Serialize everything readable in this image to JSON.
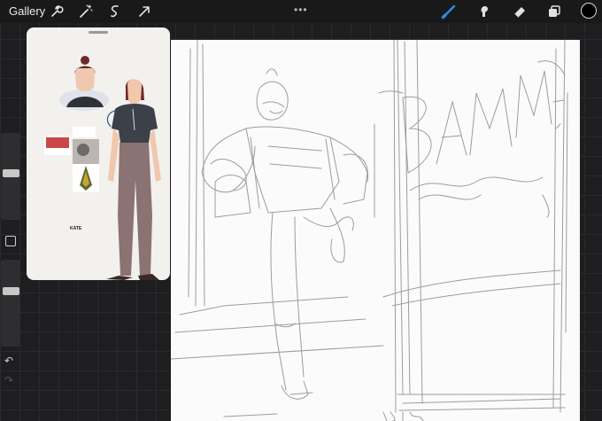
{
  "topbar": {
    "gallery_label": "Gallery",
    "left_tools": [
      "wrench-icon",
      "magic-wand-icon",
      "selection-icon",
      "transform-arrow-icon"
    ],
    "right_tools": [
      "brush-icon",
      "smudge-icon",
      "eraser-icon",
      "layers-icon"
    ],
    "more_glyph": "•••",
    "active_color": "#000000"
  },
  "reference": {
    "character_label": "KATE",
    "accent_color": "#2b8be6"
  },
  "sidebar": {
    "undo_glyph": "↶",
    "redo_glyph": "↷"
  },
  "canvas": {
    "sketch_text": "BAMM!"
  }
}
